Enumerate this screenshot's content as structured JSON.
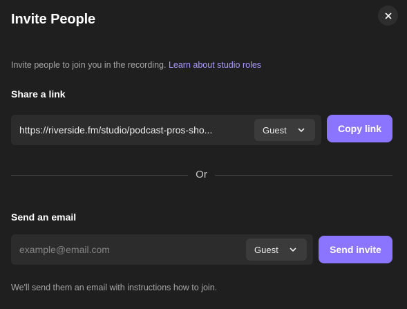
{
  "dialog": {
    "title": "Invite People",
    "subtitle": "Invite people to join you in the recording.",
    "learn_link": "Learn about studio roles"
  },
  "share": {
    "title": "Share a link",
    "link": "https://riverside.fm/studio/podcast-pros-sho...",
    "role": "Guest",
    "copy_label": "Copy link"
  },
  "divider": {
    "text": "Or"
  },
  "email": {
    "title": "Send an email",
    "placeholder": "example@email.com",
    "value": "",
    "role": "Guest",
    "send_label": "Send invite",
    "footnote": "We'll send them an email with instructions how to join."
  },
  "icons": {
    "close": "close-icon",
    "chevron": "chevron-down-icon"
  },
  "colors": {
    "background": "#1f1f1f",
    "accent": "#8b75ff",
    "link": "#a99bff",
    "field": "#2c2c2c"
  }
}
